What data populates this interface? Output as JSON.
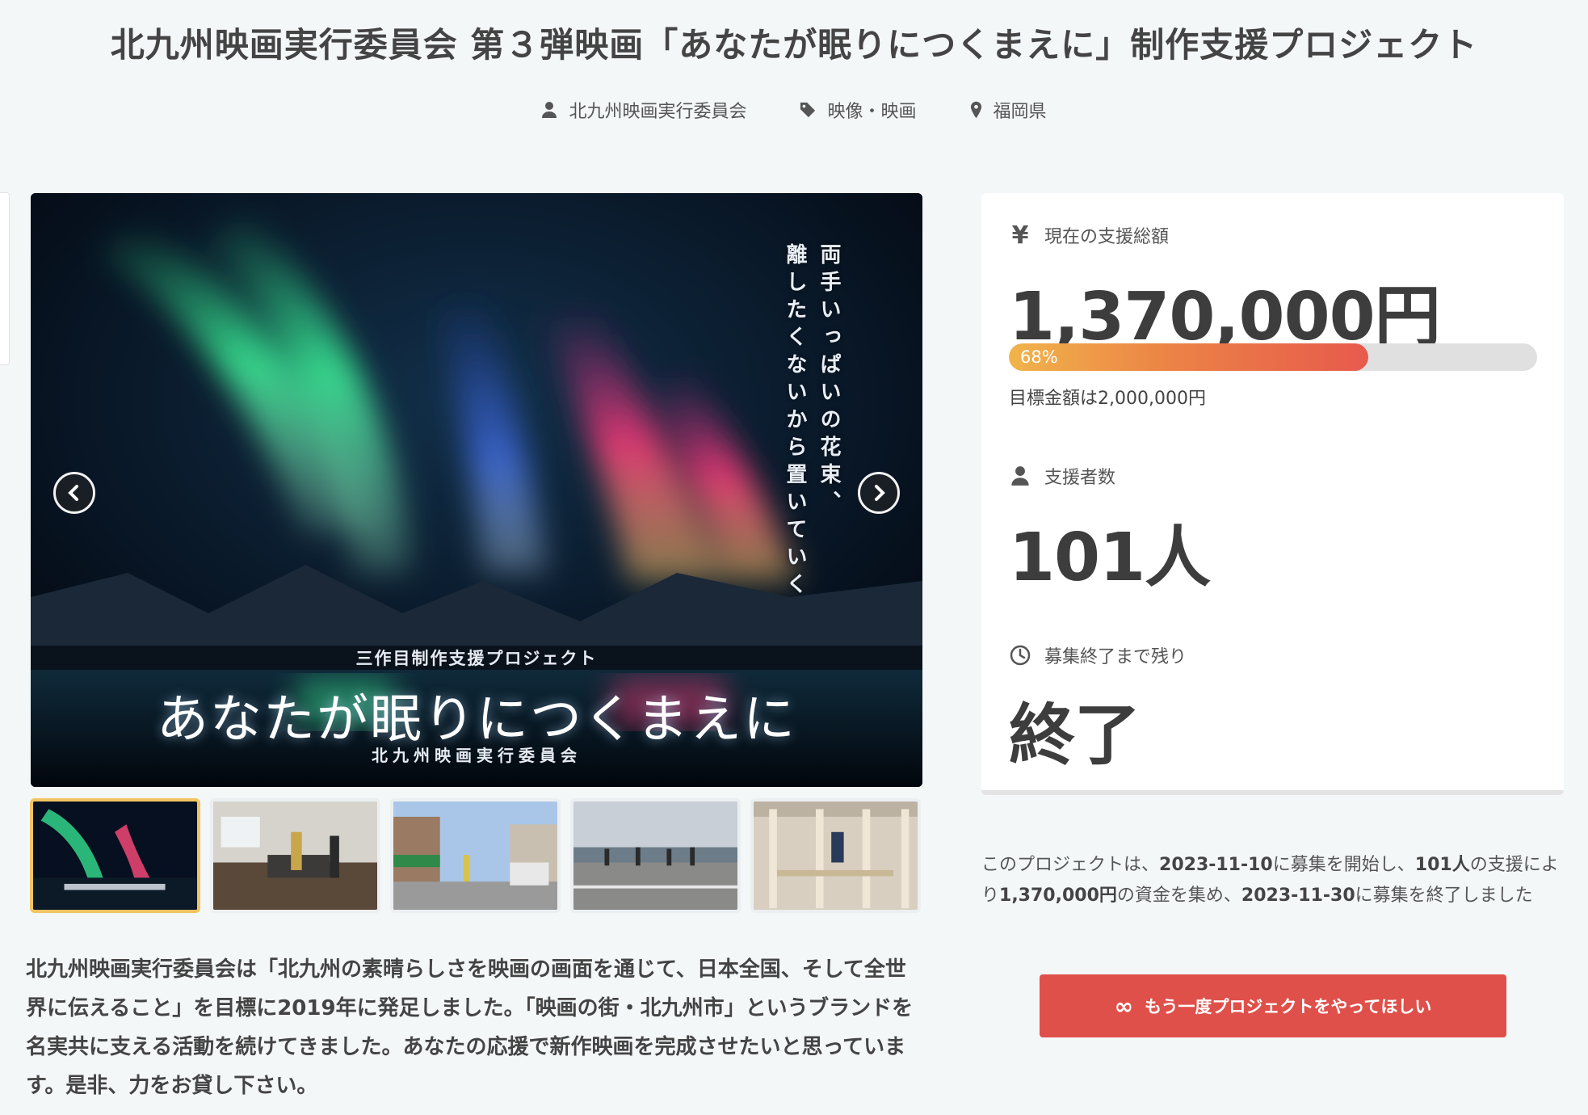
{
  "page": {
    "title": "北九州映画実行委員会 第３弾映画「あなたが眠りにつくまえに」制作支援プロジェクト"
  },
  "meta": {
    "owner": "北九州映画実行委員会",
    "category": "映像・映画",
    "location": "福岡県"
  },
  "hero": {
    "vertical_line_1": "両手いっぱいの花束、",
    "vertical_line_2": "離したくないから置いていく",
    "subtitle": "三作目制作支援プロジェクト",
    "title": "あなたが眠りにつくまえに",
    "org": "北九州映画実行委員会"
  },
  "stats": {
    "total_label": "現在の支援総額",
    "total_value": "1,370,000円",
    "progress_percent": 68,
    "progress_label": "68%",
    "goal_text": "目標金額は2,000,000円",
    "backers_label": "支援者数",
    "backers_value": "101人",
    "remaining_label": "募集終了まで残り",
    "remaining_value": "終了"
  },
  "summary": {
    "part1": "このプロジェクトは、",
    "start_date": "2023-11-10",
    "part2": "に募集を開始し、",
    "backers": "101人",
    "part3": "の支援により",
    "amount": "1,370,000円",
    "part4": "の資金を集め、",
    "end_date": "2023-11-30",
    "part5": "に募集を終了しました"
  },
  "cta": {
    "icon": "∞",
    "label": "もう一度プロジェクトをやってほしい"
  },
  "description": "北九州映画実行委員会は「北九州の素晴らしさを映画の画面を通じて、日本全国、そして全世界に伝えること」を目標に2019年に発足しました。「映画の街・北九州市」というブランドを名実共に支える活動を続けてきました。あなたの応援で新作映画を完成させたいと思っています。是非、力をお貸し下さい。",
  "colors": {
    "accent_red": "#e0504a",
    "progress_start": "#f0b44a",
    "progress_end": "#e75a4c",
    "thumb_active_border": "#f2c461"
  }
}
